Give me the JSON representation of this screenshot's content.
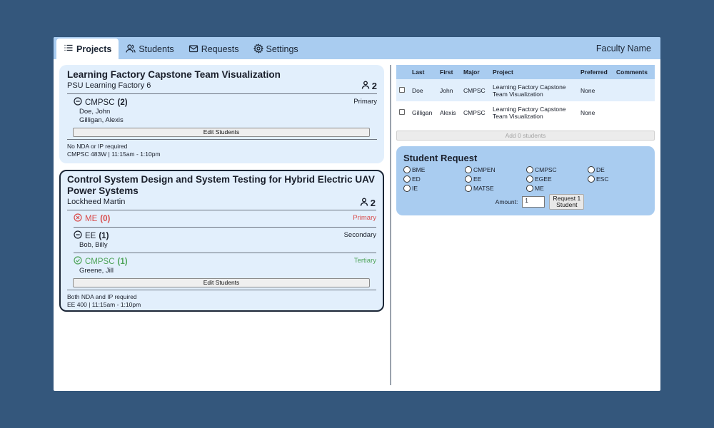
{
  "nav": {
    "tabs": [
      {
        "label": "Projects",
        "icon": "list-icon",
        "active": true
      },
      {
        "label": "Students",
        "icon": "users-icon",
        "active": false
      },
      {
        "label": "Requests",
        "icon": "mail-icon",
        "active": false
      },
      {
        "label": "Settings",
        "icon": "gear-icon",
        "active": false
      }
    ],
    "faculty_name": "Faculty Name"
  },
  "projects": [
    {
      "title": "Learning Factory Capstone Team Visualization",
      "sponsor": "PSU Learning Factory 6",
      "team_count": "2",
      "majors": [
        {
          "name": "CMPSC",
          "count": "(2)",
          "priority": "Primary",
          "status": "remove",
          "students": [
            "Doe, John",
            "Gilligan, Alexis"
          ]
        }
      ],
      "edit_label": "Edit Students",
      "footer_line1": "No NDA or IP required",
      "footer_line2": "CMPSC 483W | 11:15am - 1:10pm"
    },
    {
      "title": "Control System Design and System Testing for Hybrid Electric UAV Power Systems",
      "sponsor": "Lockheed Martin",
      "team_count": "2",
      "majors": [
        {
          "name": "ME",
          "count": "(0)",
          "priority": "Primary",
          "status": "error",
          "students": []
        },
        {
          "name": "EE",
          "count": "(1)",
          "priority": "Secondary",
          "status": "remove",
          "students": [
            "Bob, Billy"
          ]
        },
        {
          "name": "CMPSC",
          "count": "(1)",
          "priority": "Tertiary",
          "status": "ok",
          "students": [
            "Greene, Jill"
          ]
        }
      ],
      "edit_label": "Edit Students",
      "footer_line1": "Both NDA and IP required",
      "footer_line2": "EE 400 | 11:15am - 1:10pm"
    }
  ],
  "student_table": {
    "headers": [
      "",
      "Last",
      "First",
      "Major",
      "Project",
      "Preferred",
      "Comments"
    ],
    "rows": [
      {
        "last": "Doe",
        "first": "John",
        "major": "CMPSC",
        "project": "Learning Factory Capstone Team Visualization",
        "preferred": "None",
        "comments": ""
      },
      {
        "last": "Gilligan",
        "first": "Alexis",
        "major": "CMPSC",
        "project": "Learning Factory Capstone Team Visualization",
        "preferred": "None",
        "comments": ""
      }
    ],
    "add_label": "Add 0 students"
  },
  "request": {
    "title": "Student Request",
    "majors": [
      "BME",
      "CMPEN",
      "CMPSC",
      "DE",
      "ED",
      "EE",
      "EGEE",
      "ESC",
      "IE",
      "MATSE",
      "ME"
    ],
    "amount_label": "Amount:",
    "amount_value": "1",
    "button_label": "Request 1 Student"
  },
  "colors": {
    "background": "#34577c",
    "nav": "#a9ccf0",
    "card": "#e2effc",
    "error": "#d94b4b",
    "ok": "#4fa45a"
  }
}
